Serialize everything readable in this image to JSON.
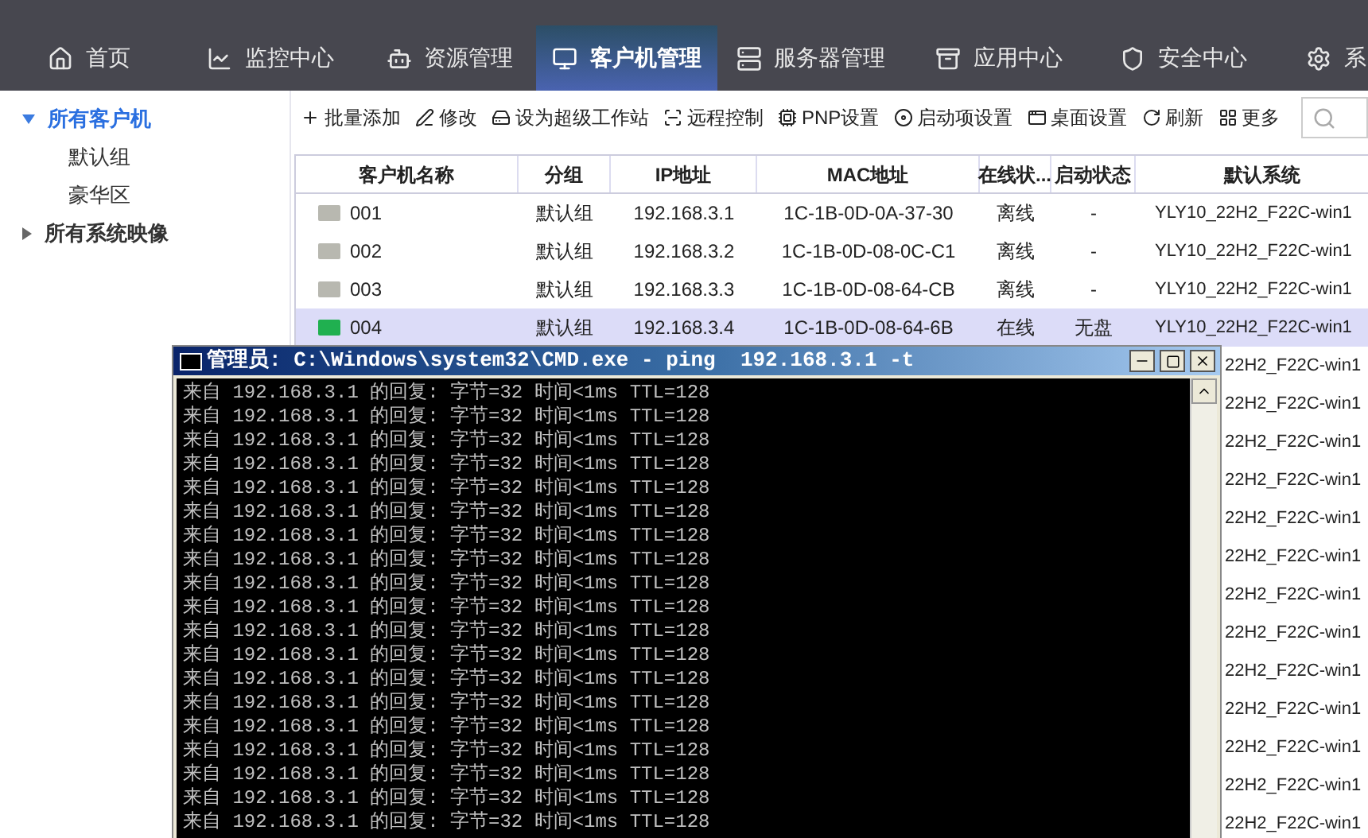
{
  "nav": {
    "tabs": [
      {
        "label": "首页",
        "selected": false
      },
      {
        "label": "监控中心",
        "selected": false
      },
      {
        "label": "资源管理",
        "selected": false
      },
      {
        "label": "客户机管理",
        "selected": true
      },
      {
        "label": "服务器管理",
        "selected": false
      },
      {
        "label": "应用中心",
        "selected": false
      },
      {
        "label": "安全中心",
        "selected": false
      },
      {
        "label": "系",
        "selected": false
      }
    ]
  },
  "sidebar": {
    "items": [
      {
        "label": "所有客户机",
        "expanded": true,
        "selected": true,
        "children": [
          {
            "label": "默认组",
            "selected": false
          },
          {
            "label": "豪华区",
            "selected": false
          }
        ]
      },
      {
        "label": "所有系统映像",
        "expanded": false,
        "selected": false
      }
    ]
  },
  "toolbar": {
    "buttons": [
      "批量添加",
      "修改",
      "设为超级工作站",
      "远程控制",
      "PNP设置",
      "启动项设置",
      "桌面设置",
      "刷新",
      "更多"
    ]
  },
  "table": {
    "columns": [
      "客户机名称",
      "分组",
      "IP地址",
      "MAC地址",
      "在线状...",
      "启动状态",
      "默认系统"
    ],
    "rows": [
      {
        "cells": [
          "001",
          "默认组",
          "192.168.3.1",
          "1C-1B-0D-0A-37-30",
          "离线",
          "-",
          "YLY10_22H2_F22C-win1"
        ],
        "online": false,
        "selected": false
      },
      {
        "cells": [
          "002",
          "默认组",
          "192.168.3.2",
          "1C-1B-0D-08-0C-C1",
          "离线",
          "-",
          "YLY10_22H2_F22C-win1"
        ],
        "online": false,
        "selected": false
      },
      {
        "cells": [
          "003",
          "默认组",
          "192.168.3.3",
          "1C-1B-0D-08-64-CB",
          "离线",
          "-",
          "YLY10_22H2_F22C-win1"
        ],
        "online": false,
        "selected": false
      },
      {
        "cells": [
          "004",
          "默认组",
          "192.168.3.4",
          "1C-1B-0D-08-64-6B",
          "在线",
          "无盘",
          "YLY10_22H2_F22C-win1"
        ],
        "online": true,
        "selected": true
      }
    ],
    "covered_rows": [
      "22H2_F22C-win1",
      "22H2_F22C-win1",
      "22H2_F22C-win1",
      "22H2_F22C-win1",
      "22H2_F22C-win1",
      "22H2_F22C-win1",
      "22H2_F22C-win1",
      "22H2_F22C-win1",
      "22H2_F22C-win1",
      "22H2_F22C-win1",
      "22H2_F22C-win1",
      "22H2_F22C-win1",
      "22H2_F22C-win1"
    ]
  },
  "console": {
    "title": "管理员: C:\\Windows\\system32\\CMD.exe - ping  192.168.3.1 -t",
    "lines": [
      "来自 192.168.3.1 的回复: 字节=32 时间<1ms TTL=128",
      "来自 192.168.3.1 的回复: 字节=32 时间<1ms TTL=128",
      "来自 192.168.3.1 的回复: 字节=32 时间<1ms TTL=128",
      "来自 192.168.3.1 的回复: 字节=32 时间<1ms TTL=128",
      "来自 192.168.3.1 的回复: 字节=32 时间<1ms TTL=128",
      "来自 192.168.3.1 的回复: 字节=32 时间<1ms TTL=128",
      "来自 192.168.3.1 的回复: 字节=32 时间<1ms TTL=128",
      "来自 192.168.3.1 的回复: 字节=32 时间<1ms TTL=128",
      "来自 192.168.3.1 的回复: 字节=32 时间<1ms TTL=128",
      "来自 192.168.3.1 的回复: 字节=32 时间<1ms TTL=128",
      "来自 192.168.3.1 的回复: 字节=32 时间<1ms TTL=128",
      "来自 192.168.3.1 的回复: 字节=32 时间<1ms TTL=128",
      "来自 192.168.3.1 的回复: 字节=32 时间<1ms TTL=128",
      "来自 192.168.3.1 的回复: 字节=32 时间<1ms TTL=128",
      "来自 192.168.3.1 的回复: 字节=32 时间<1ms TTL=128",
      "来自 192.168.3.1 的回复: 字节=32 时间<1ms TTL=128",
      "来自 192.168.3.1 的回复: 字节=32 时间<1ms TTL=128",
      "来自 192.168.3.1 的回复: 字节=32 时间<1ms TTL=128",
      "来自 192.168.3.1 的回复: 字节=32 时间<1ms TTL=128"
    ]
  }
}
